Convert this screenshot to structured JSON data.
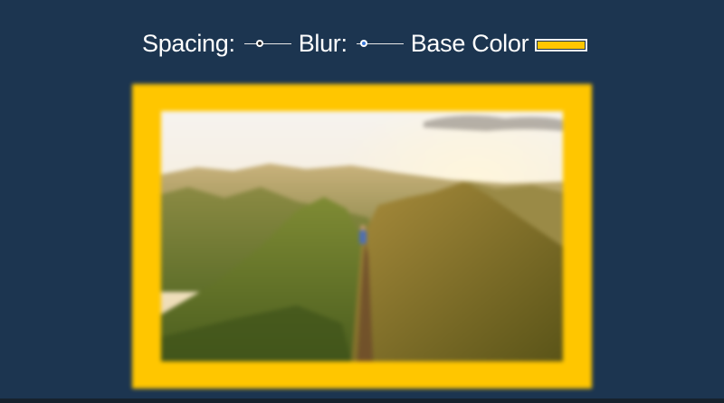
{
  "controls": {
    "spacing_label": "Spacing:",
    "spacing_value": 0.3,
    "blur_label": "Blur:",
    "blur_value": 0.1,
    "base_color_label": "Base Color",
    "base_color_value": "#ffc600"
  },
  "colors": {
    "background": "#1c3550",
    "frame": "#ffc600",
    "slider_accent": "#3a78d8"
  },
  "image": {
    "subject": "hiker on a grassy mountain ridge at sunrise",
    "icon": "photo-image"
  }
}
